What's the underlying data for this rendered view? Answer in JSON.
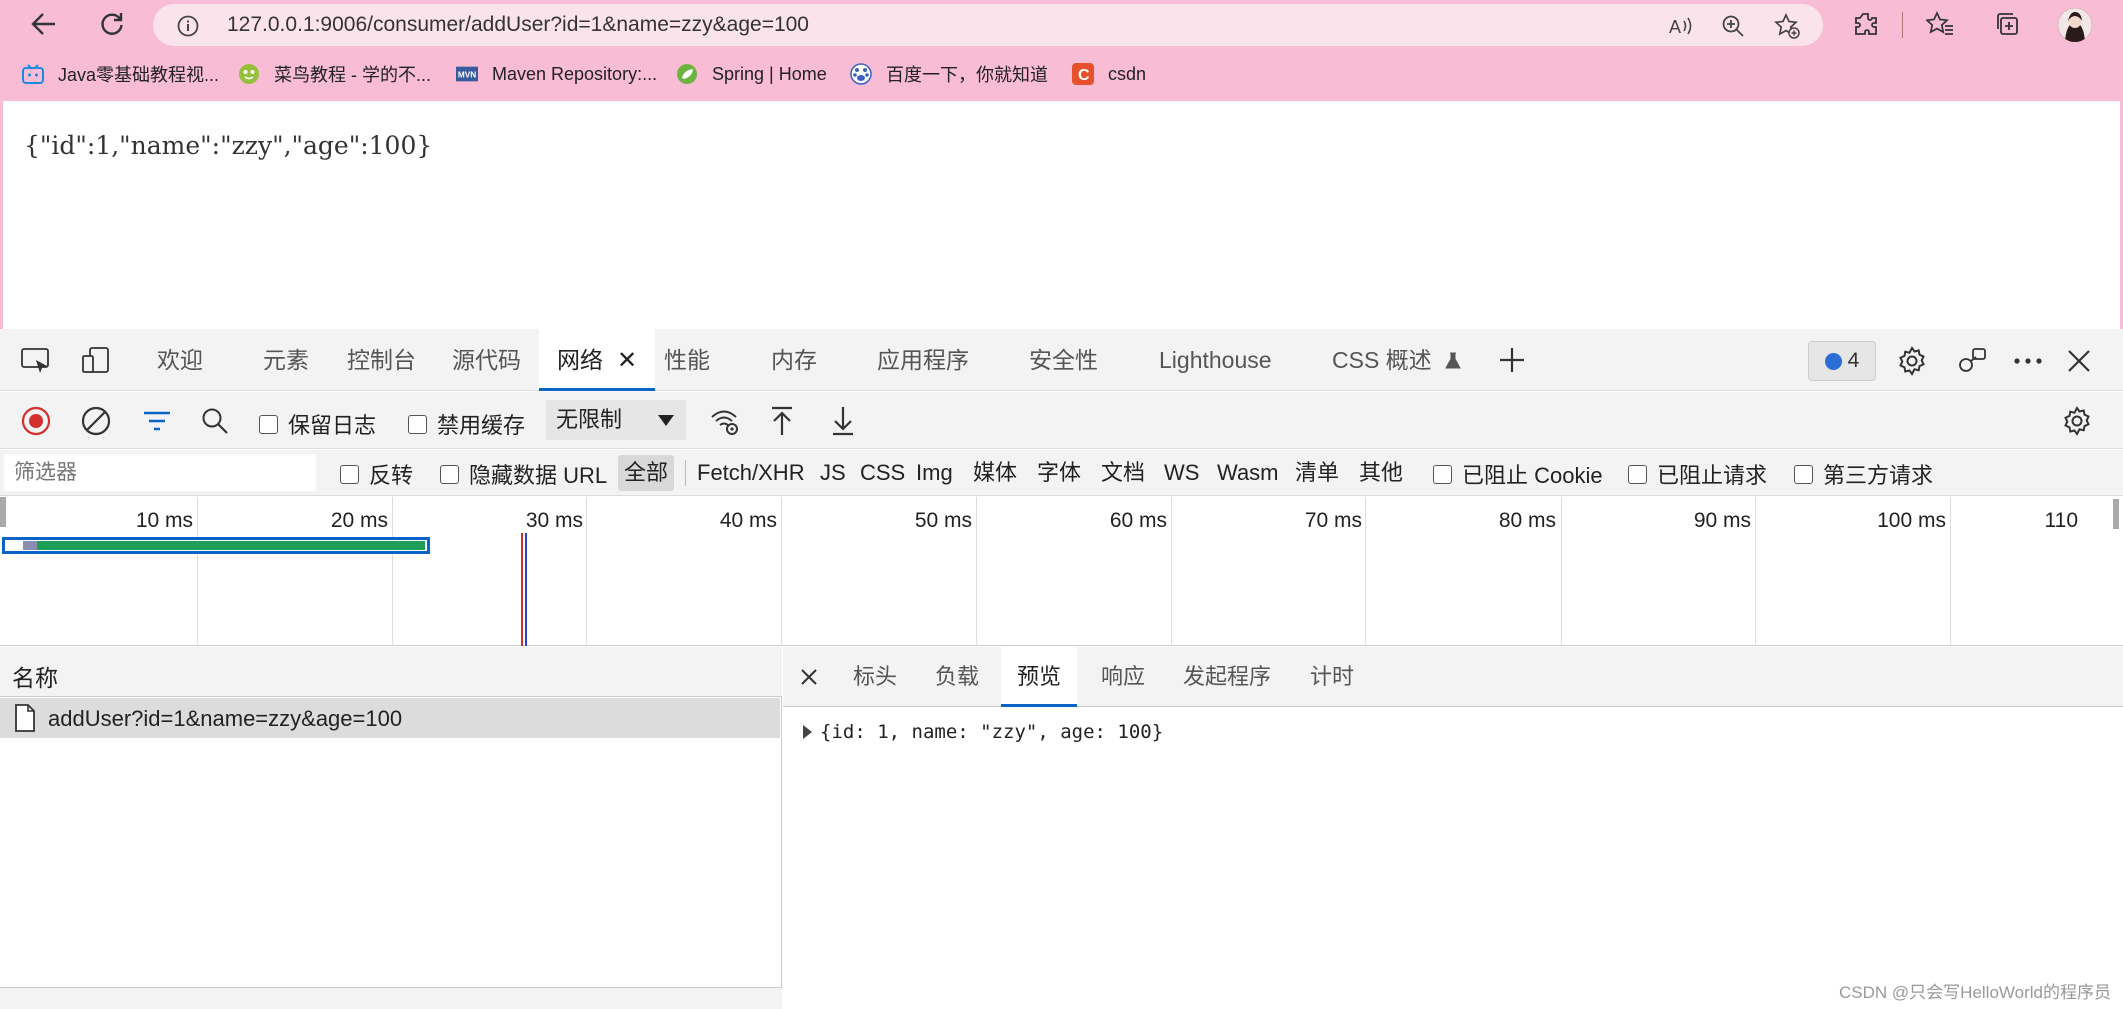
{
  "browser": {
    "url": "127.0.0.1:9006/consumer/addUser?id=1&name=zzy&age=100",
    "bookmarks": [
      {
        "label": "Java零基础教程视...",
        "icon": "bilibili-icon"
      },
      {
        "label": "菜鸟教程 - 学的不...",
        "icon": "runoob-icon"
      },
      {
        "label": "Maven Repository:...",
        "icon": "maven-icon"
      },
      {
        "label": "Spring | Home",
        "icon": "spring-icon"
      },
      {
        "label": "百度一下，你就知道",
        "icon": "baidu-icon"
      },
      {
        "label": "csdn",
        "icon": "csdn-icon"
      }
    ]
  },
  "page": {
    "body_text": "{\"id\":1,\"name\":\"zzy\",\"age\":100}"
  },
  "devtools": {
    "tabs": [
      "欢迎",
      "元素",
      "控制台",
      "源代码",
      "网络",
      "性能",
      "内存",
      "应用程序",
      "安全性",
      "Lighthouse",
      "CSS 概述"
    ],
    "active_tab": "网络",
    "issues_count": "4",
    "toolbar": {
      "preserve_log": "保留日志",
      "disable_cache": "禁用缓存",
      "throttling": "无限制"
    },
    "filter": {
      "placeholder": "筛选器",
      "invert": "反转",
      "hide_data_urls": "隐藏数据 URL",
      "types": [
        "全部",
        "Fetch/XHR",
        "JS",
        "CSS",
        "Img",
        "媒体",
        "字体",
        "文档",
        "WS",
        "Wasm",
        "清单",
        "其他"
      ],
      "selected_type": "全部",
      "blocked_cookies": "已阻止 Cookie",
      "blocked_requests": "已阻止请求",
      "third_party": "第三方请求"
    },
    "timeline": {
      "ticks": [
        "10 ms",
        "20 ms",
        "30 ms",
        "40 ms",
        "50 ms",
        "60 ms",
        "70 ms",
        "80 ms",
        "90 ms",
        "100 ms",
        "110"
      ]
    },
    "name_column": "名称",
    "requests": [
      "addUser?id=1&name=zzy&age=100"
    ],
    "detail_tabs": [
      "标头",
      "负载",
      "预览",
      "响应",
      "发起程序",
      "计时"
    ],
    "active_detail_tab": "预览",
    "preview": "{id: 1, name: \"zzy\", age: 100}"
  },
  "watermark": "CSDN @只会写HelloWorld的程序员",
  "colors": {
    "chrome_bg": "#f8bcd4",
    "accent_blue": "#0a64c8",
    "record_red": "#d32f2f",
    "waterfall_green": "#1e9e57"
  }
}
